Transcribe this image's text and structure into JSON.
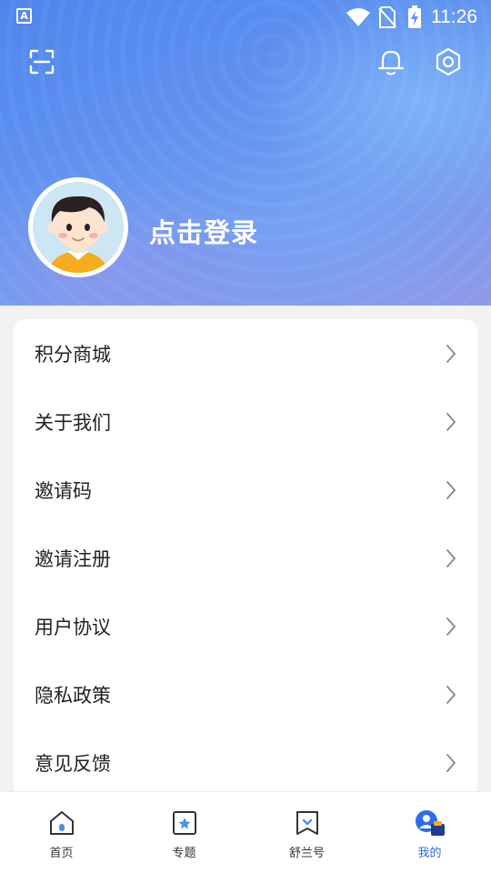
{
  "status_bar": {
    "time": "11:26",
    "app_icon_letter": "A"
  },
  "header": {
    "scan_icon": "scan-icon",
    "notification_icon": "bell-icon",
    "settings_icon": "gear-icon",
    "login_label": "点击登录"
  },
  "menu": {
    "items": [
      {
        "label": "积分商城"
      },
      {
        "label": "关于我们"
      },
      {
        "label": "邀请码"
      },
      {
        "label": "邀请注册"
      },
      {
        "label": "用户协议"
      },
      {
        "label": "隐私政策"
      },
      {
        "label": "意见反馈"
      }
    ]
  },
  "tabbar": {
    "tabs": [
      {
        "label": "首页",
        "icon": "home-icon"
      },
      {
        "label": "专题",
        "icon": "topic-icon"
      },
      {
        "label": "舒兰号",
        "icon": "bookmark-icon"
      },
      {
        "label": "我的",
        "icon": "profile-icon"
      }
    ],
    "active_index": 3
  },
  "colors": {
    "accent": "#2d6de8",
    "hero_start": "#4f86ec",
    "hero_end": "#8f9ae8"
  }
}
